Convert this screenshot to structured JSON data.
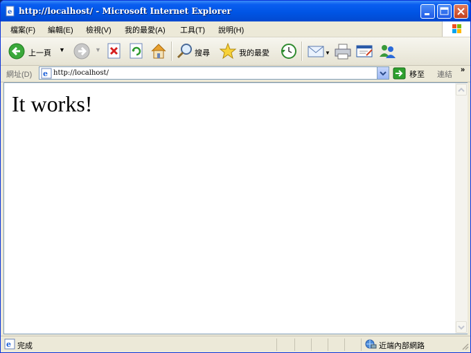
{
  "window": {
    "title": "http://localhost/ - Microsoft Internet Explorer"
  },
  "menubar": {
    "items": [
      {
        "label": "檔案(F)"
      },
      {
        "label": "編輯(E)"
      },
      {
        "label": "檢視(V)"
      },
      {
        "label": "我的最愛(A)"
      },
      {
        "label": "工具(T)"
      },
      {
        "label": "說明(H)"
      }
    ]
  },
  "toolbar": {
    "back_label": "上一頁",
    "search_label": "搜尋",
    "favorites_label": "我的最愛"
  },
  "address": {
    "label": "網址(D)",
    "value": "http://localhost/",
    "go_label": "移至",
    "links_label": "連結"
  },
  "page": {
    "heading": "It works!"
  },
  "status": {
    "text": "完成",
    "zone": "近端內部網路"
  },
  "colors": {
    "titlebar": "#0055e5",
    "chrome": "#ece9d8",
    "close_button": "#c2401d"
  }
}
